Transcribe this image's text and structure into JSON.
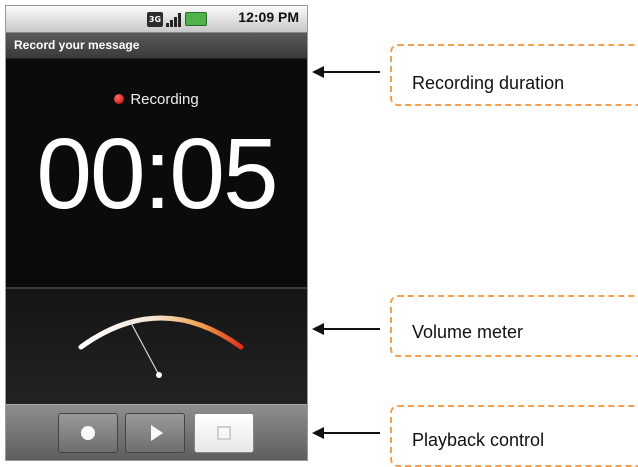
{
  "status_bar": {
    "network_badge": "3G",
    "time": "12:09 PM",
    "icons": [
      "3g-icon",
      "signal-icon",
      "battery-icon"
    ]
  },
  "app": {
    "title": "Record your message"
  },
  "recorder": {
    "status_text": "Recording",
    "elapsed_time": "00:05"
  },
  "controls": {
    "buttons": [
      {
        "name": "record-button",
        "icon": "record-icon"
      },
      {
        "name": "play-button",
        "icon": "play-icon"
      },
      {
        "name": "stop-button",
        "icon": "stop-icon",
        "active": true
      }
    ]
  },
  "annotations": [
    {
      "label": "Recording duration",
      "target": "timer"
    },
    {
      "label": "Volume meter",
      "target": "volume-meter"
    },
    {
      "label": "Playback control",
      "target": "control-bar"
    }
  ],
  "colors": {
    "recording_dot": "#e00000",
    "callout_border": "#f0a050",
    "meter_high": "#e0301a"
  }
}
